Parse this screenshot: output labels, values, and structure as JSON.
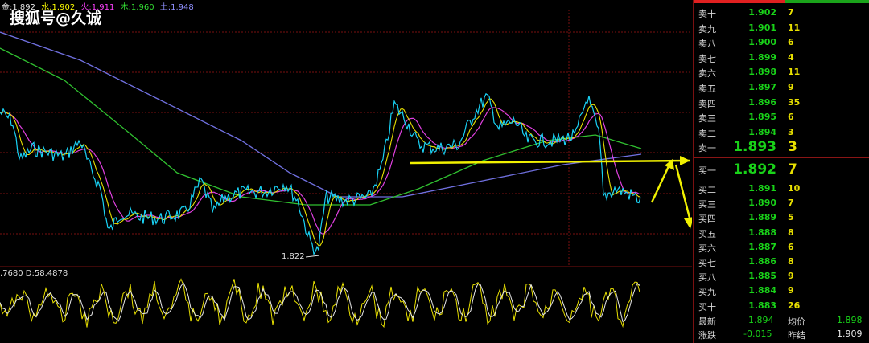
{
  "ma_legend": [
    {
      "text": "金:1.892",
      "color": "#e8e8e8"
    },
    {
      "text": "水:1.902",
      "color": "#ffff00"
    },
    {
      "text": "火:1.911",
      "color": "#ff40ff"
    },
    {
      "text": "木:1.960",
      "color": "#33dd33"
    },
    {
      "text": "土:1.948",
      "color": "#9090ff"
    }
  ],
  "watermark": "搜狐号@久诚",
  "kd_legend": ".7680  D:58.4878",
  "low_label": "1.822",
  "colors": {
    "price_line": "#19d2f5",
    "ma_yellow": "#e8e000",
    "ma_magenta": "#e040e0",
    "ma_green": "#30c030",
    "ma_blue": "#7070e0",
    "grid_red": "#7a1010",
    "annotation": "#f0f000",
    "price_green": "#19d219",
    "volume_yellow": "#e8e000"
  },
  "orderbook": {
    "sells": [
      {
        "label": "卖十",
        "price": "1.902",
        "volume": "7"
      },
      {
        "label": "卖九",
        "price": "1.901",
        "volume": "11"
      },
      {
        "label": "卖八",
        "price": "1.900",
        "volume": "6"
      },
      {
        "label": "卖七",
        "price": "1.899",
        "volume": "4"
      },
      {
        "label": "卖六",
        "price": "1.898",
        "volume": "11"
      },
      {
        "label": "卖五",
        "price": "1.897",
        "volume": "9"
      },
      {
        "label": "卖四",
        "price": "1.896",
        "volume": "35"
      },
      {
        "label": "卖三",
        "price": "1.895",
        "volume": "6"
      },
      {
        "label": "卖二",
        "price": "1.894",
        "volume": "3"
      },
      {
        "label": "卖一",
        "price": "1.893",
        "volume": "3"
      }
    ],
    "buys": [
      {
        "label": "买一",
        "price": "1.892",
        "volume": "7"
      },
      {
        "label": "买二",
        "price": "1.891",
        "volume": "10"
      },
      {
        "label": "买三",
        "price": "1.890",
        "volume": "7"
      },
      {
        "label": "买四",
        "price": "1.889",
        "volume": "5"
      },
      {
        "label": "买五",
        "price": "1.888",
        "volume": "8"
      },
      {
        "label": "买六",
        "price": "1.887",
        "volume": "6"
      },
      {
        "label": "买七",
        "price": "1.886",
        "volume": "8"
      },
      {
        "label": "买八",
        "price": "1.885",
        "volume": "9"
      },
      {
        "label": "买九",
        "price": "1.884",
        "volume": "9"
      },
      {
        "label": "买十",
        "price": "1.883",
        "volume": "26"
      }
    ],
    "stats": {
      "latest_label": "最新",
      "latest_value": "1.894",
      "avg_label": "均价",
      "avg_value": "1.898",
      "change_label": "涨跌",
      "change_value": "-0.015",
      "prev_label": "昨结",
      "prev_value": "1.909"
    }
  }
}
